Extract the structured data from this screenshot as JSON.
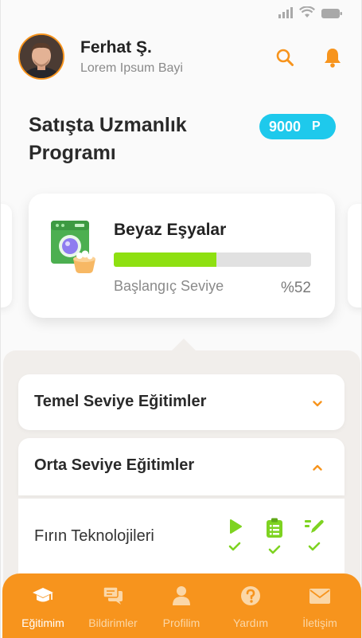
{
  "user": {
    "name": "Ferhat Ş.",
    "role": "Lorem Ipsum Bayi"
  },
  "icons": {
    "search": "search-icon",
    "notifications": "bell-icon"
  },
  "page": {
    "title": "Satışta Uzmanlık Programı"
  },
  "points": {
    "value": "9000",
    "unit": "P"
  },
  "course": {
    "title": "Beyaz Eşyalar",
    "level": "Başlangıç Seviye",
    "percent_label": "%52",
    "progress": 0.52
  },
  "sections": [
    {
      "title": "Temel Seviye Eğitimler",
      "expanded": false
    },
    {
      "title": "Orta Seviye Eğitimler",
      "expanded": true
    }
  ],
  "lesson": {
    "title": "Fırın Teknolojileri",
    "items": [
      {
        "icon": "play-icon",
        "completed": true
      },
      {
        "icon": "clipboard-icon",
        "completed": true
      },
      {
        "icon": "pencil-icon",
        "completed": true
      }
    ]
  },
  "nav": [
    {
      "label": "Eğitimim",
      "icon": "graduation-cap-icon",
      "active": true
    },
    {
      "label": "Bildirimler",
      "icon": "chat-icon",
      "active": false
    },
    {
      "label": "Profilim",
      "icon": "user-icon",
      "active": false
    },
    {
      "label": "Yardım",
      "icon": "question-icon",
      "active": false
    },
    {
      "label": "İletişim",
      "icon": "mail-icon",
      "active": false
    }
  ],
  "colors": {
    "accent": "#f7941d",
    "badge": "#1ec9ec",
    "progress": "#8ee011",
    "check": "#7ed321"
  }
}
